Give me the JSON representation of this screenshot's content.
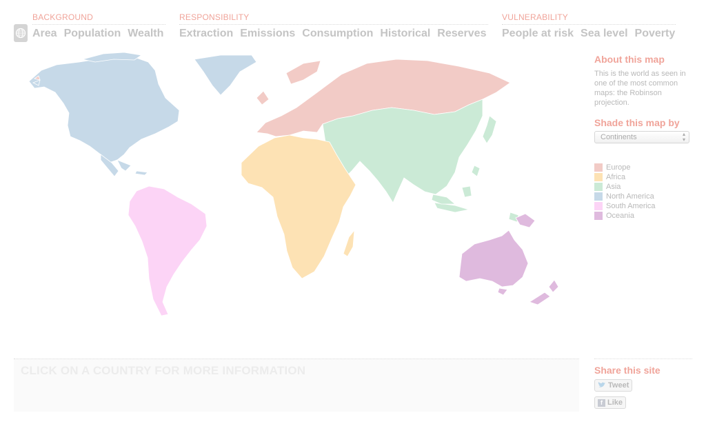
{
  "nav": {
    "background": {
      "label": "BACKGROUND",
      "items": [
        "Area",
        "Population",
        "Wealth"
      ]
    },
    "responsibility": {
      "label": "RESPONSIBILITY",
      "items": [
        "Extraction",
        "Emissions",
        "Consumption",
        "Historical",
        "Reserves"
      ]
    },
    "vulnerability": {
      "label": "VULNERABILITY",
      "items": [
        "People at risk",
        "Sea level",
        "Poverty"
      ]
    }
  },
  "icons": {
    "home": "globe-icon",
    "tweet": "twitter-bird-icon",
    "like": "facebook-icon",
    "select": "select-arrows-icon"
  },
  "sidebar": {
    "about_title": "About this map",
    "about_text": "This is the world as seen in one of the most common maps: the Robinson projection.",
    "shade_title": "Shade this map by",
    "shade_value": "Continents"
  },
  "legend": [
    {
      "label": "Europe",
      "color": "#f2cbc6"
    },
    {
      "label": "Africa",
      "color": "#fde2b4"
    },
    {
      "label": "Asia",
      "color": "#cbead6"
    },
    {
      "label": "North America",
      "color": "#c6d9e8"
    },
    {
      "label": "South America",
      "color": "#fcd4f6"
    },
    {
      "label": "Oceania",
      "color": "#dfbade"
    }
  ],
  "info": {
    "prompt": "CLICK ON A COUNTRY FOR MORE INFORMATION"
  },
  "share": {
    "title": "Share this site",
    "tweet": "Tweet",
    "like": "Like"
  },
  "colors": {
    "accent": "#f0a49a",
    "nav_text": "#c4c4c4"
  }
}
